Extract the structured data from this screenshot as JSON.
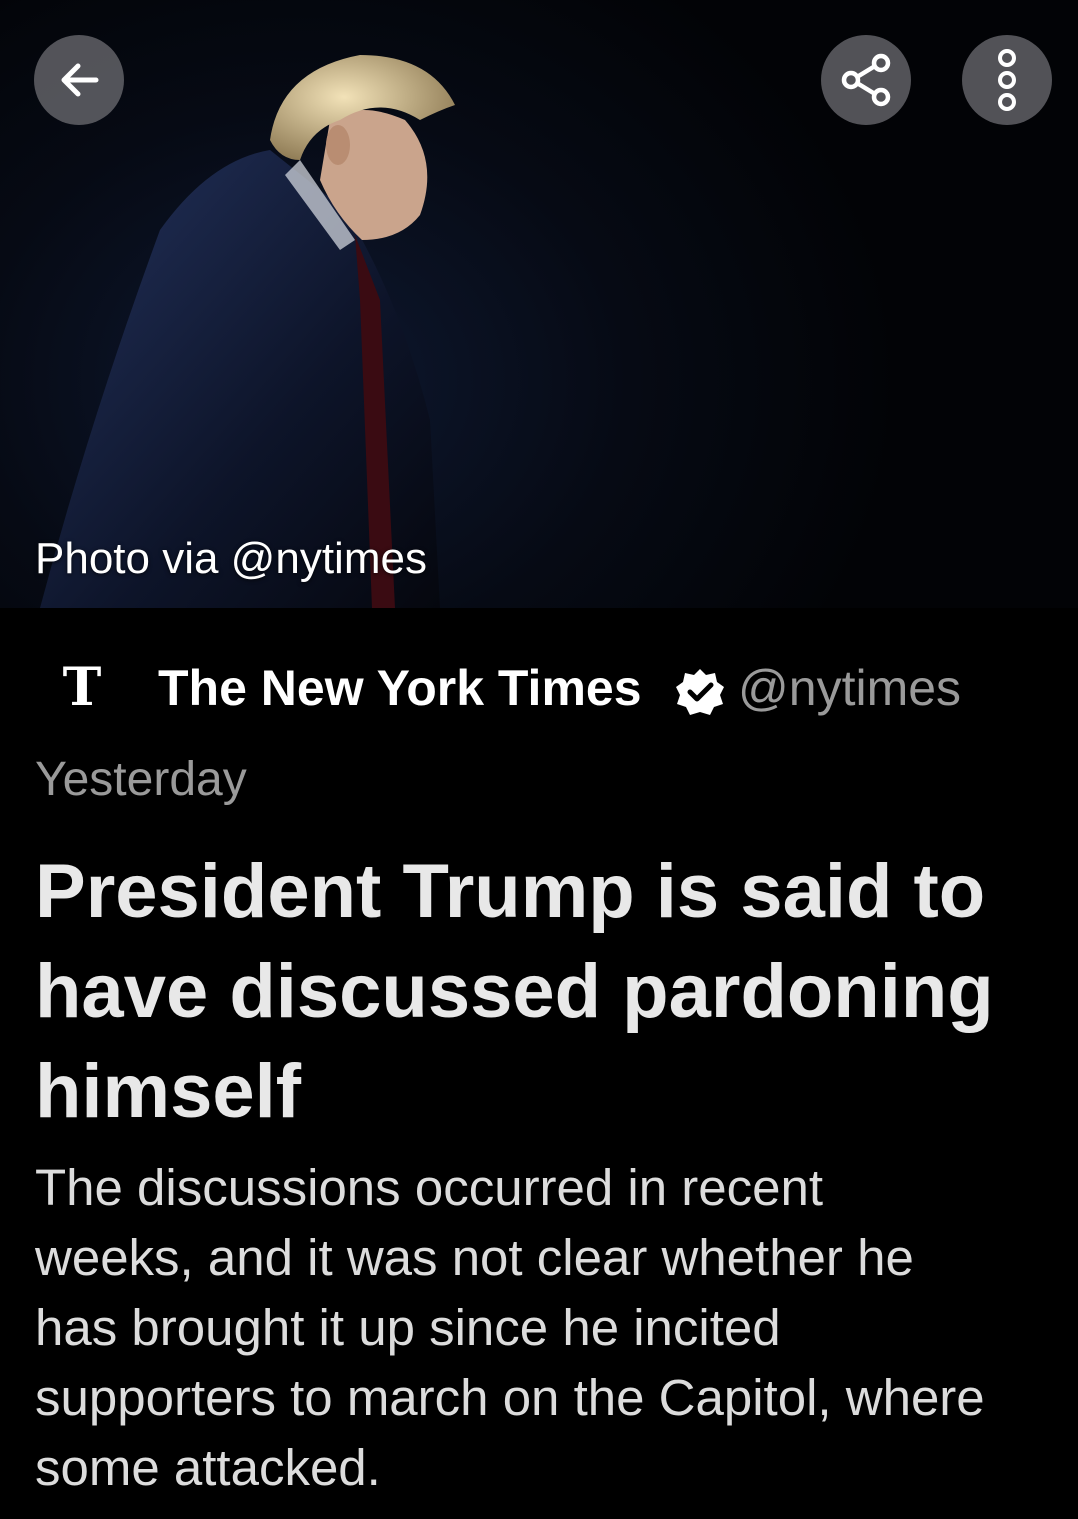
{
  "hero": {
    "photo_credit": "Photo via @nytimes"
  },
  "toolbar": {
    "back_icon": "arrow-left-icon",
    "share_icon": "share-icon",
    "more_icon": "more-vertical-icon"
  },
  "author": {
    "logo_text": "T",
    "name": "The New York Times",
    "verified": true,
    "handle": "@nytimes"
  },
  "post": {
    "timestamp": "Yesterday",
    "headline": "President Trump is said to have discussed pardoning himself",
    "summary": "The discussions occurred in recent weeks, and it was not clear whether he has brought it up since he incited supporters to march on the Capitol, where some attacked."
  },
  "colors": {
    "background": "#000000",
    "secondary_text": "#9a9a9a",
    "button_bg": "#6e6e73"
  }
}
